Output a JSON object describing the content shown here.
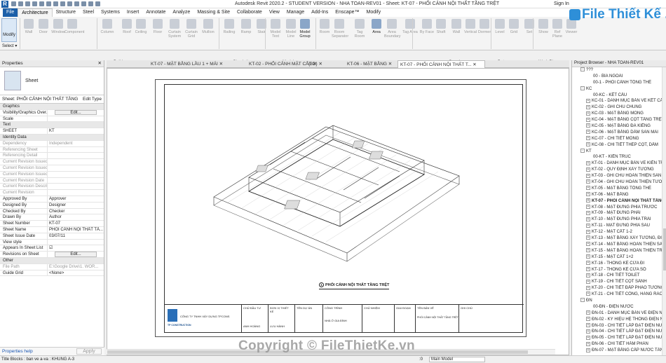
{
  "app": {
    "title": "Autodesk Revit 2020.2 - STUDENT VERSION - NHA TOAN-REV01 - Sheet: KT-07 - PHỐI CẢNH NỘI THẤT TẦNG TRỆT",
    "sign_in": "Sign In",
    "brand": "File Thiết Kế .vn",
    "logo": "R"
  },
  "ribbon_tabs": [
    "File",
    "Architecture",
    "Structure",
    "Steel",
    "Systems",
    "Insert",
    "Annotate",
    "Analyze",
    "Massing & Site",
    "Collaborate",
    "View",
    "Manage",
    "Add-Ins",
    "Enscape™",
    "Modify"
  ],
  "ribbon_active": "Architecture",
  "ribbon": {
    "modify": "Modify",
    "select": "Select ▾",
    "buttons": [
      "Wall",
      "Door",
      "Window",
      "Component",
      "Column",
      "Roof",
      "Ceiling",
      "Floor",
      "Curtain System",
      "Curtain Grid",
      "Mullion",
      "Railing",
      "Ramp",
      "Stair",
      "Model Text",
      "Model Line",
      "Model Group",
      "Room",
      "Room Separator",
      "Tag Room",
      "Area",
      "Area Boundary",
      "Tag Area",
      "By Face",
      "Shaft",
      "Wall",
      "Vertical",
      "Dormer",
      "Level",
      "Grid",
      "Set",
      "Show",
      "Ref Plane",
      "Viewer"
    ],
    "panels": [
      "Build",
      "Circulation",
      "Model",
      "Room & Area ▾",
      "Opening",
      "Datum",
      "Work Plane"
    ]
  },
  "properties": {
    "header": "Properties",
    "type_name": "Sheet",
    "selector": "Sheet: PHỐI CẢNH NỘI THẤT TẦNG",
    "edit_type": "Edit Type",
    "rows": [
      {
        "k": "Graphics",
        "v": "",
        "grp": true
      },
      {
        "k": "Visibility/Graphics Over...",
        "v": "",
        "btn": "Edit..."
      },
      {
        "k": "Scale",
        "v": ""
      },
      {
        "k": "Text",
        "v": "",
        "grp": true
      },
      {
        "k": "SHEET",
        "v": "KT"
      },
      {
        "k": "Identity Data",
        "v": "",
        "grp": true
      },
      {
        "k": "Dependency",
        "v": "Independent",
        "dim": true
      },
      {
        "k": "Referencing Sheet",
        "v": "",
        "dim": true
      },
      {
        "k": "Referencing Detail",
        "v": "",
        "dim": true
      },
      {
        "k": "Current Revision Issued",
        "v": "",
        "dim": true
      },
      {
        "k": "Current Revision Issued ...",
        "v": "",
        "dim": true
      },
      {
        "k": "Current Revision Issued ...",
        "v": "",
        "dim": true
      },
      {
        "k": "Current Revision Date",
        "v": "",
        "dim": true
      },
      {
        "k": "Current Revision Descri...",
        "v": "",
        "dim": true
      },
      {
        "k": "Current Revision",
        "v": "",
        "dim": true
      },
      {
        "k": "Approved By",
        "v": "Approver"
      },
      {
        "k": "Designed By",
        "v": "Designer"
      },
      {
        "k": "Checked By",
        "v": "Checker"
      },
      {
        "k": "Drawn By",
        "v": "Author"
      },
      {
        "k": "Sheet Number",
        "v": "KT-07"
      },
      {
        "k": "Sheet Name",
        "v": "PHỐI CẢNH NỘI THẤT TẦ..."
      },
      {
        "k": "Sheet Issue Date",
        "v": "03/07/11"
      },
      {
        "k": "View style",
        "v": ""
      },
      {
        "k": "Appears In Sheet List",
        "v": "☑"
      },
      {
        "k": "Revisions on Sheet",
        "v": "",
        "btn": "Edit..."
      },
      {
        "k": "Other",
        "v": "",
        "grp": true
      },
      {
        "k": "File Path",
        "v": "E:\\Google Drive\\1. WOR...",
        "dim": true
      },
      {
        "k": "Guide Grid",
        "v": "<None>"
      }
    ],
    "help": "Properties help",
    "apply": "Apply"
  },
  "view_tabs": [
    {
      "label": "KT-07 - MẶT BẰNG LẦU 1 + MÁI",
      "active": false
    },
    {
      "label": "KT-02 - PHỐI CẢNH MẶT CẮT",
      "active": false
    },
    {
      "label": "{3D}",
      "active": false
    },
    {
      "label": "KT-06 - MẶT BẰNG",
      "active": false
    },
    {
      "label": "KT-07 - PHỐI CẢNH NỘI THẤT T...",
      "active": true
    }
  ],
  "sheet": {
    "view_number": "1",
    "view_title": "PHỐI CẢNH NỘI THẤT TẦNG TRỆT",
    "company": "CÔNG TY TNHH XÂY DỰNG TPCONS",
    "logo_text": "TP CONSTRUCTION",
    "tb_cells": [
      "CHỦ ĐẦU TƯ",
      "ĐƠN VỊ THIẾT KẾ",
      "TÊN DỰ ÁN",
      "CÔNG TRÌNH",
      "CHỦ NHIỆM",
      "KIẾN TRÚC",
      "GIAI ĐOẠN",
      "TÊN BẢN VẼ",
      "GHI CHÚ"
    ],
    "tb_values": [
      "ANH HOÀNG",
      "LƯU HÀNH",
      "NHÀ Ở GIA ĐÌNH",
      "PHỐI CẢNH NỘI THẤT TẦNG TRỆT",
      "KT-07"
    ]
  },
  "browser": {
    "header": "Project Browser - NHA TOAN-REV01",
    "items": [
      {
        "t": "??? ",
        "lvl": 0,
        "exp": "-"
      },
      {
        "t": "00 - BÌA NGOÀI",
        "lvl": 2
      },
      {
        "t": "00-1 - PHỐI CẢNH TỔNG THỂ",
        "lvl": 2
      },
      {
        "t": "KC",
        "lvl": 0,
        "exp": "-"
      },
      {
        "t": "00-KC - KẾT CẤU",
        "lvl": 2
      },
      {
        "t": "KC-01 - DANH MỤC BẢN VẼ KẾT CẤU",
        "lvl": 1,
        "exp": "+"
      },
      {
        "t": "KC-02 - GHI CHÚ CHUNG",
        "lvl": 1,
        "exp": "+"
      },
      {
        "t": "KC-03 - MẶT BẰNG MÓNG",
        "lvl": 1,
        "exp": "+"
      },
      {
        "t": "KC-04 - MẶT BẰNG CỘT TẦNG TRỆT",
        "lvl": 1,
        "exp": "+"
      },
      {
        "t": "KC-05 - MẶT BẰNG ĐÀ KIỀNG",
        "lvl": 1,
        "exp": "+"
      },
      {
        "t": "KC-06 - MẶT BẰNG DẦM SÀN MÁI",
        "lvl": 1,
        "exp": "+"
      },
      {
        "t": "KC-07 - CHI TIẾT MÓNG",
        "lvl": 1,
        "exp": "+"
      },
      {
        "t": "KC-08 - CHI TIẾT THÉP CỘT, DẦM",
        "lvl": 1,
        "exp": "+"
      },
      {
        "t": "KT",
        "lvl": 0,
        "exp": "-"
      },
      {
        "t": "00-KT - KIẾN TRÚC",
        "lvl": 2
      },
      {
        "t": "KT-01 - DANH MỤC BẢN VẼ KIẾN TRÚC",
        "lvl": 1,
        "exp": "+"
      },
      {
        "t": "KT-02 - QUY ĐỊNH XÂY TƯỜNG",
        "lvl": 1,
        "exp": "+"
      },
      {
        "t": "KT-03 - GHI CHÚ HOÀN THIỆN SÀN",
        "lvl": 1,
        "exp": "+"
      },
      {
        "t": "KT-04 - GHI CHÚ HOÀN THIỆN TƯỜNG",
        "lvl": 1,
        "exp": "+"
      },
      {
        "t": "KT-05 - MẶT BẰNG TỔNG THỂ",
        "lvl": 1,
        "exp": "+"
      },
      {
        "t": "KT-06 - MẶT BẰNG",
        "lvl": 1,
        "exp": "+"
      },
      {
        "t": "KT-07 - PHỐI CẢNH NỘI THẤT TẦNG",
        "lvl": 1,
        "exp": "+",
        "bold": true
      },
      {
        "t": "KT-08 - MẶT ĐỨNG PHÍA TRƯỚC",
        "lvl": 1,
        "exp": "+"
      },
      {
        "t": "KT-09 - MẶT ĐỨNG PHẢI",
        "lvl": 1,
        "exp": "+"
      },
      {
        "t": "KT-10 - MẶT ĐỨNG PHÍA TRÁI",
        "lvl": 1,
        "exp": "+"
      },
      {
        "t": "KT-11 - MẶT ĐỨNG PHÍA SAU",
        "lvl": 1,
        "exp": "+"
      },
      {
        "t": "KT-12 - MẶT CẮT 1-2",
        "lvl": 1,
        "exp": "+"
      },
      {
        "t": "KT-13 - MẶT BẰNG XÂY TƯỜNG, ĐI",
        "lvl": 1,
        "exp": "+"
      },
      {
        "t": "KT-14 - MẶT BẰNG HOÀN THIỆN SÀN",
        "lvl": 1,
        "exp": "+"
      },
      {
        "t": "KT-15 - MẶT BẰNG HOÀN THIỆN TRẦN",
        "lvl": 1,
        "exp": "+"
      },
      {
        "t": "KT-15 - MẶT CẮT 1+2",
        "lvl": 1,
        "exp": "+"
      },
      {
        "t": "KT-16 - THỐNG KÊ CỬA ĐI",
        "lvl": 1,
        "exp": "+"
      },
      {
        "t": "KT-17 - THỐNG KÊ CỬA SỔ",
        "lvl": 1,
        "exp": "+"
      },
      {
        "t": "KT-18 - CHI TIẾT TOILET",
        "lvl": 1,
        "exp": "+"
      },
      {
        "t": "KT-19 - CHI TIẾT CỘT SẢNH",
        "lvl": 1,
        "exp": "+"
      },
      {
        "t": "KT-20 - CHI TIẾT ĐẮP PHÀO TƯỜNG",
        "lvl": 1,
        "exp": "+"
      },
      {
        "t": "KT-21 - CHI TIẾT CỔNG, HÀNG RÀO",
        "lvl": 1,
        "exp": "+"
      },
      {
        "t": "ĐN",
        "lvl": 0,
        "exp": "-"
      },
      {
        "t": "00-ĐN - ĐIỆN NƯỚC",
        "lvl": 2
      },
      {
        "t": "ĐN-01 - DANH MỤC BẢN VẼ ĐIỆN NƯỚC",
        "lvl": 1,
        "exp": "+"
      },
      {
        "t": "ĐN-02 - KÝ HIỆU HỆ THỐNG ĐIỆN NƯỚC",
        "lvl": 1,
        "exp": "+"
      },
      {
        "t": "ĐN-03 - CHI TIẾT LẮP ĐẶT ĐIỆN NƯỚC",
        "lvl": 1,
        "exp": "+"
      },
      {
        "t": "ĐN-04 - CHI TIẾT LẮP ĐẶT ĐIỆN NƯỚC",
        "lvl": 1,
        "exp": "+"
      },
      {
        "t": "ĐN-05 - CHI TIẾT LẮP ĐẶT ĐIỆN NƯỚC",
        "lvl": 1,
        "exp": "+"
      },
      {
        "t": "ĐN-06 - CHI TIẾT HẦM PHÂN",
        "lvl": 1,
        "exp": "+"
      },
      {
        "t": "ĐN-07 - MẶT BẰNG CẤP NƯỚC TẦNG",
        "lvl": 1,
        "exp": "+"
      }
    ]
  },
  "status": {
    "text": "Title Blocks : ban ve a-va : KHUNG A-3",
    "model": "Main Model",
    "coords": ":0"
  },
  "watermark": "Copyright © FileThietKe.vn"
}
